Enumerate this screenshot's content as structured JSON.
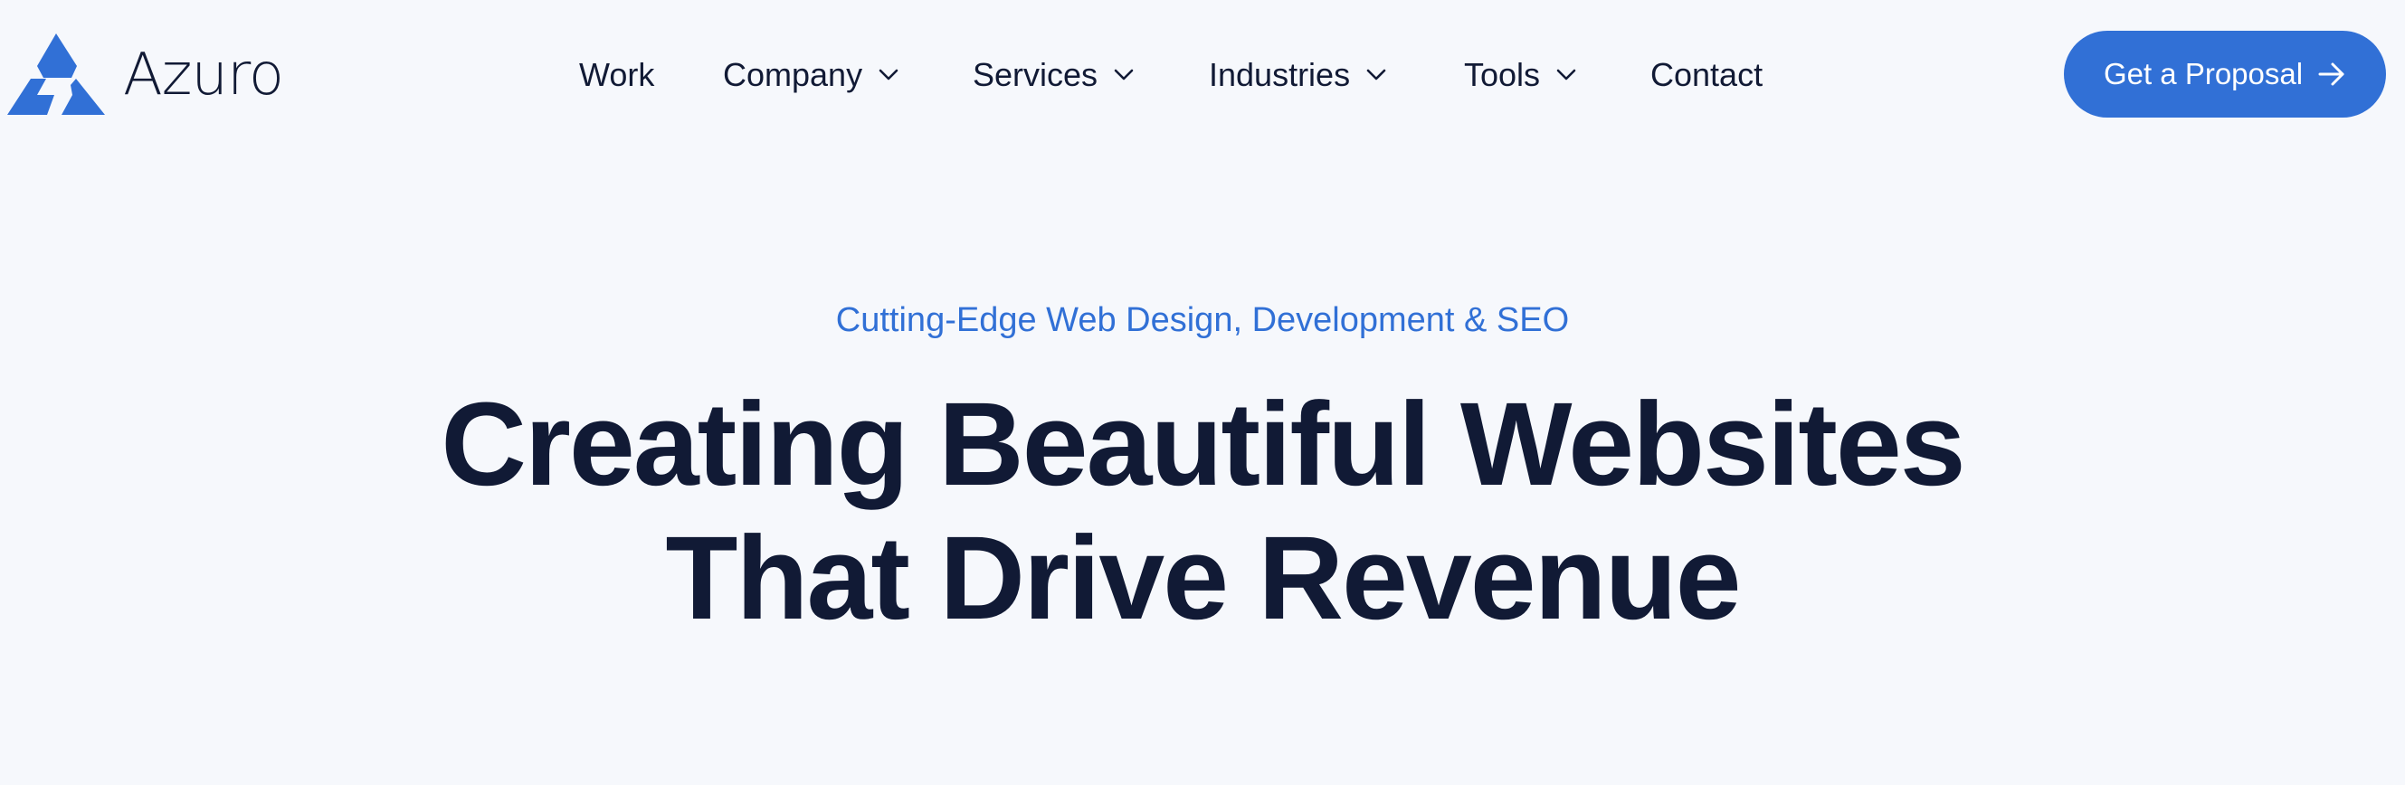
{
  "brand": {
    "name": "Azuro",
    "logo_icon": "triangle-logo-icon",
    "accent_color": "#3170d6",
    "text_color": "#111a35",
    "background_color": "#f6f8fc"
  },
  "nav": {
    "items": [
      {
        "label": "Work",
        "has_dropdown": false
      },
      {
        "label": "Company",
        "has_dropdown": true
      },
      {
        "label": "Services",
        "has_dropdown": true
      },
      {
        "label": "Industries",
        "has_dropdown": true
      },
      {
        "label": "Tools",
        "has_dropdown": true
      },
      {
        "label": "Contact",
        "has_dropdown": false
      }
    ],
    "dropdown_icon": "chevron-down-icon"
  },
  "cta": {
    "label": "Get a Proposal",
    "icon": "arrow-right-icon"
  },
  "hero": {
    "eyebrow": "Cutting-Edge Web Design, Development & SEO",
    "headline_line1": "Creating Beautiful Websites",
    "headline_line2": "That Drive Revenue"
  }
}
